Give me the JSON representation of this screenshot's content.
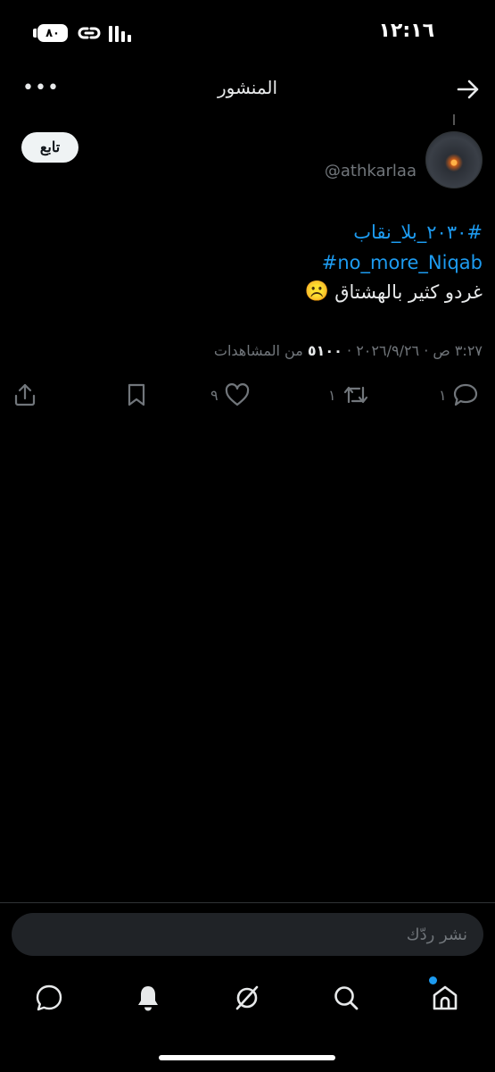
{
  "status_bar": {
    "time": "١٢:١٦",
    "battery": "٨٠"
  },
  "header": {
    "title": "المنشور"
  },
  "author": {
    "handle": "@athkarlaa",
    "follow_label": "تابع"
  },
  "post": {
    "hashtag_1": "#٢٠٣٠_بلا_نقاب",
    "hashtag_2": "#no_more_Niqab",
    "text": "غردو كثير بالهشتاق",
    "emoji": "☹️",
    "timestamp": "٣:٢٧ ص · ٢٠٢٦/٩/٢٦ · ",
    "views_count": "٥١٠٠",
    "views_label": " من المشاهدات"
  },
  "actions": {
    "replies": "١",
    "reposts": "١",
    "likes": "٩"
  },
  "compose": {
    "placeholder": "نشر ردّك"
  },
  "colors": {
    "accent": "#1d9bf0",
    "background": "#000000",
    "muted": "#71767b"
  }
}
